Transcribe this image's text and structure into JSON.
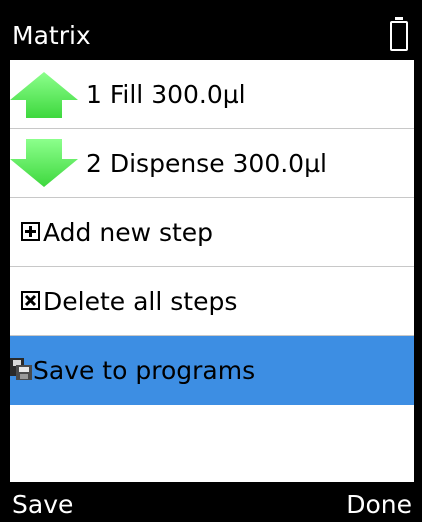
{
  "header": {
    "title": "Matrix",
    "battery_icon": "battery-icon"
  },
  "steps": [
    {
      "label": "1  Fill 300.0µl",
      "icon": "arrow-up-icon",
      "color": "#5cf05c"
    },
    {
      "label": "2  Dispense 300.0µl",
      "icon": "arrow-down-icon",
      "color": "#5cf05c"
    }
  ],
  "actions": {
    "add_label": "Add new step",
    "delete_label": "Delete all steps",
    "save_label": "Save to programs"
  },
  "softkeys": {
    "left": "Save",
    "right": "Done"
  },
  "colors": {
    "selection": "#3d8ee3",
    "arrow": "#5cf05c"
  }
}
